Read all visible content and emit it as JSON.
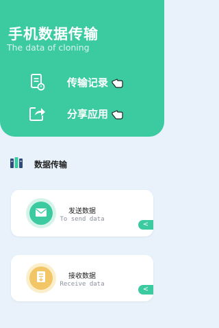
{
  "header": {
    "title": "手机数据传输",
    "subtitle": "The data of cloning",
    "menu": [
      {
        "label": "传输记录",
        "icon": "document-clock-icon"
      },
      {
        "label": "分享应用",
        "icon": "share-icon"
      }
    ]
  },
  "section": {
    "title": "数据传输",
    "icon": "books-icon"
  },
  "cards": [
    {
      "title": "发送数据",
      "subtitle": "To send data",
      "icon": "envelope-icon",
      "arrow": "<",
      "color": "#3ccaa0"
    },
    {
      "title": "接收数据",
      "subtitle": "Receive data",
      "icon": "inbox-doc-icon",
      "arrow": "<",
      "color": "#f2c567"
    }
  ],
  "colors": {
    "accent": "#3ccaa0",
    "background": "#e9f2fa",
    "receive": "#f2c567"
  }
}
